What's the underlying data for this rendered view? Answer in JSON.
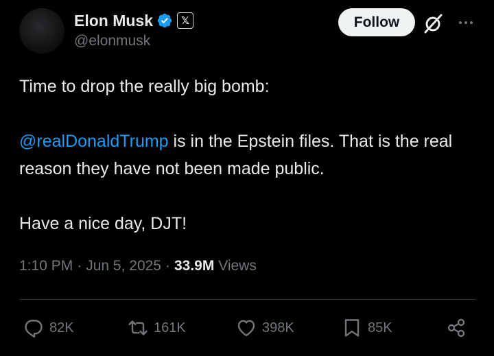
{
  "author": {
    "display_name": "Elon Musk",
    "handle": "@elonmusk",
    "affiliate_badge": "𝕏",
    "verified_icon": "verified-badge-icon"
  },
  "header": {
    "follow_label": "Follow"
  },
  "tweet": {
    "line1": "Time to drop the really big bomb:",
    "mention": "@realDonaldTrump",
    "line2_rest": " is in the Epstein files. That is the real reason they have not been made public.",
    "line3": "Have a nice day, DJT!"
  },
  "meta": {
    "time": "1:10 PM",
    "separator": "·",
    "date": "Jun 5, 2025",
    "views_count": "33.9M",
    "views_label": "Views"
  },
  "actions": {
    "replies": "82K",
    "reposts": "161K",
    "likes": "398K",
    "bookmarks": "85K"
  },
  "colors": {
    "background": "#000000",
    "text": "#e7e9ea",
    "secondary": "#71767b",
    "link": "#1d9bf0",
    "verified": "#1d9bf0",
    "divider": "#2f3336"
  }
}
